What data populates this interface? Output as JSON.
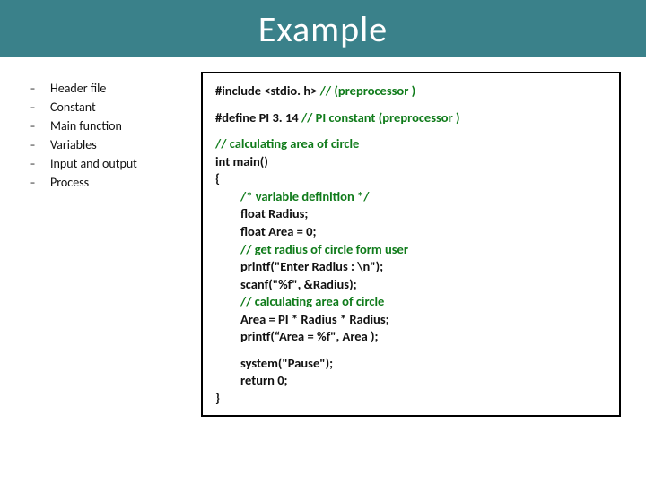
{
  "title": "Example",
  "bullets": {
    "items": [
      {
        "label": "Header file"
      },
      {
        "label": "Constant"
      },
      {
        "label": "Main function"
      },
      {
        "label": "Variables"
      },
      {
        "label": "Input and output"
      },
      {
        "label": "Process"
      }
    ],
    "dash": "–"
  },
  "code": {
    "l1a": "#include <stdio. h>  ",
    "l1c": "// (preprocessor )",
    "l2a": "#define   PI    3. 14 ",
    "l2c": "// PI  constant (preprocessor )",
    "l3c": "//  calculating  area of circle",
    "l4": "int main()",
    "l5": "{",
    "l6c": "/* variable definition */",
    "l7": "float  Radius;",
    "l8": "float  Area = 0;",
    "l9c": "// get radius of circle form user",
    "l10": "printf(\"Enter Radius : \\n\");",
    "l11": "scanf(\"%f\",  &Radius);",
    "l12c": "// calculating  area of circle",
    "l13": "Area  =  PI  *  Radius * Radius;",
    "l14": "printf(“Area  =  %f\",  Area );",
    "l15": "system(\"Pause\");",
    "l16": "return 0;",
    "l17": "}"
  }
}
